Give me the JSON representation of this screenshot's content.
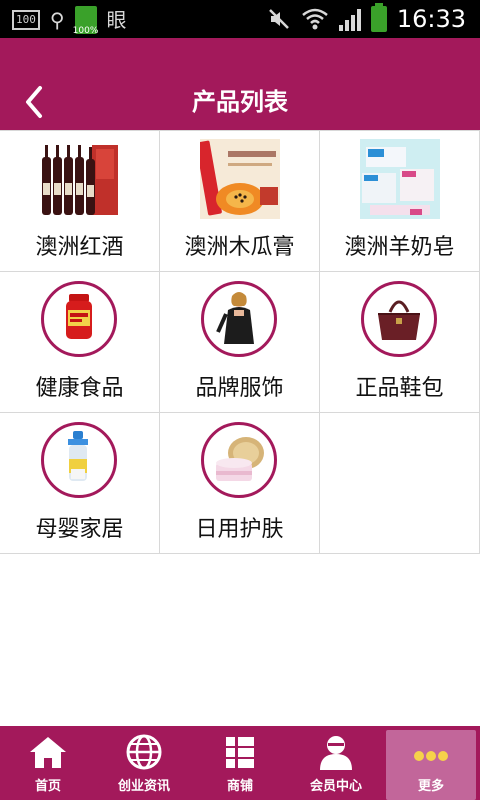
{
  "status_bar": {
    "left_box": "100",
    "battery_small_percent": "100%",
    "doc_glyph": "眼",
    "time": "16:33"
  },
  "header": {
    "title": "产品列表",
    "back_label": "返回"
  },
  "products": [
    {
      "label": "澳洲红酒",
      "icon": "wine-bottles-image",
      "style": "photo"
    },
    {
      "label": "澳洲木瓜膏",
      "icon": "papaya-cream-image",
      "style": "photo"
    },
    {
      "label": "澳洲羊奶皂",
      "icon": "goat-milk-soap-image",
      "style": "photo"
    },
    {
      "label": "健康食品",
      "icon": "supplement-bottle-image",
      "style": "circle"
    },
    {
      "label": "品牌服饰",
      "icon": "fashion-model-image",
      "style": "circle"
    },
    {
      "label": "正品鞋包",
      "icon": "handbag-image",
      "style": "circle"
    },
    {
      "label": "母婴家居",
      "icon": "baby-bottle-image",
      "style": "circle"
    },
    {
      "label": "日用护肤",
      "icon": "cream-jar-image",
      "style": "circle"
    }
  ],
  "bottom_nav": [
    {
      "label": "首页",
      "icon": "home-icon"
    },
    {
      "label": "创业资讯",
      "icon": "globe-icon"
    },
    {
      "label": "商铺",
      "icon": "grid-list-icon"
    },
    {
      "label": "会员中心",
      "icon": "user-icon"
    },
    {
      "label": "更多",
      "icon": "more-dots-icon",
      "active": true
    }
  ],
  "colors": {
    "brand": "#a3195b",
    "nav_active": "#c2669a",
    "grid_line": "#d8d8d8"
  }
}
